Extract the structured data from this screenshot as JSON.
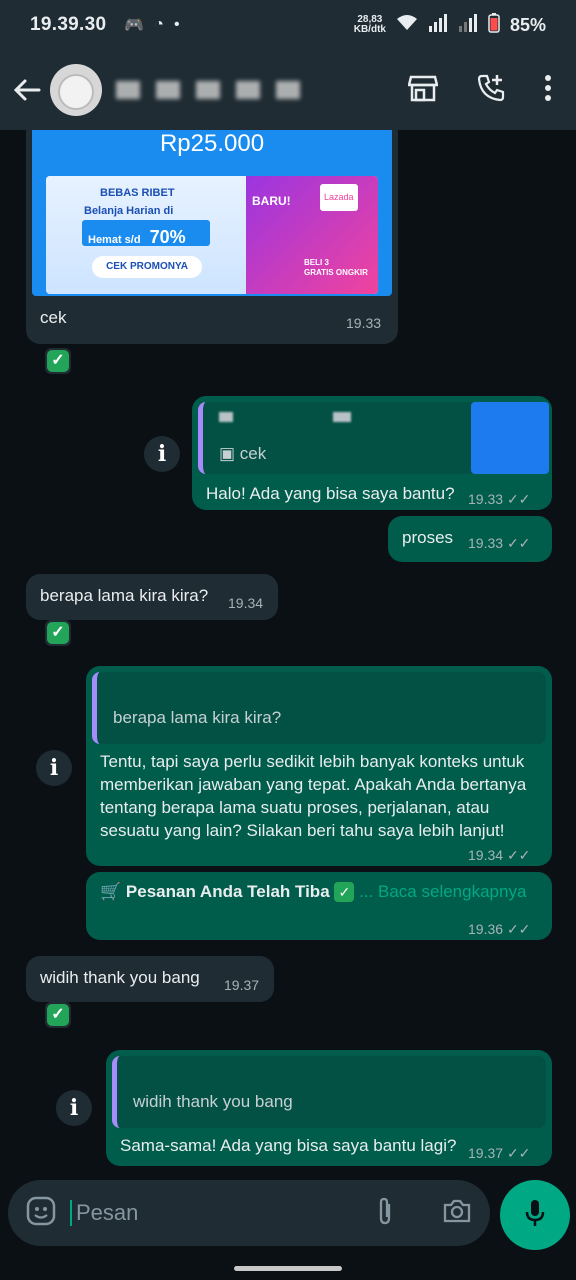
{
  "status": {
    "time": "19.39.30",
    "speed_top": "28,83",
    "speed_bottom": "KB/dtk",
    "battery": "85%"
  },
  "header": {
    "icons": [
      "back-arrow-icon",
      "store-icon",
      "add-call-icon",
      "more-vert-icon"
    ]
  },
  "promo": {
    "amount": "Rp25.000",
    "brand": "BEBAS RIBET",
    "tagline": "Belanja Harian di",
    "hemat": "Hemat s/d",
    "percent": "70%",
    "cta": "CEK PROMONYA",
    "baru": "BARU!",
    "shop": "Lazada",
    "beli": "BELI 3",
    "gratis": "GRATIS ONGKIR"
  },
  "messages": {
    "m1_text": "cek",
    "m1_time": "19.33",
    "m2_quote": "cek",
    "m2_text": "Halo! Ada yang bisa saya bantu?",
    "m2_time": "19.33",
    "m3_text": "proses",
    "m3_time": "19.33",
    "m4_text": "berapa lama kira kira?",
    "m4_time": "19.34",
    "m5_quote": "berapa lama kira kira?",
    "m5_text": "Tentu, tapi saya perlu sedikit lebih banyak konteks untuk memberikan jawaban yang tepat. Apakah Anda bertanya tentang berapa lama suatu proses, perjalanan, atau sesuatu yang lain? Silakan beri tahu saya lebih lanjut!",
    "m5_time": "19.34",
    "m6_text": "Pesanan Anda Telah Tiba",
    "m6_more": "... Baca selengkapnya",
    "m6_time": "19.36",
    "m7_text": "widih thank you bang",
    "m7_time": "19.37",
    "m8_quote": "widih thank you bang",
    "m8_text": "Sama-sama! Ada yang bisa saya bantu lagi?",
    "m8_time": "19.37"
  },
  "input": {
    "placeholder": "Pesan"
  },
  "colors": {
    "incoming": "#1f2c34",
    "outgoing": "#005c4b",
    "accent": "#00a884",
    "quote_bar": "#a78bfa"
  }
}
